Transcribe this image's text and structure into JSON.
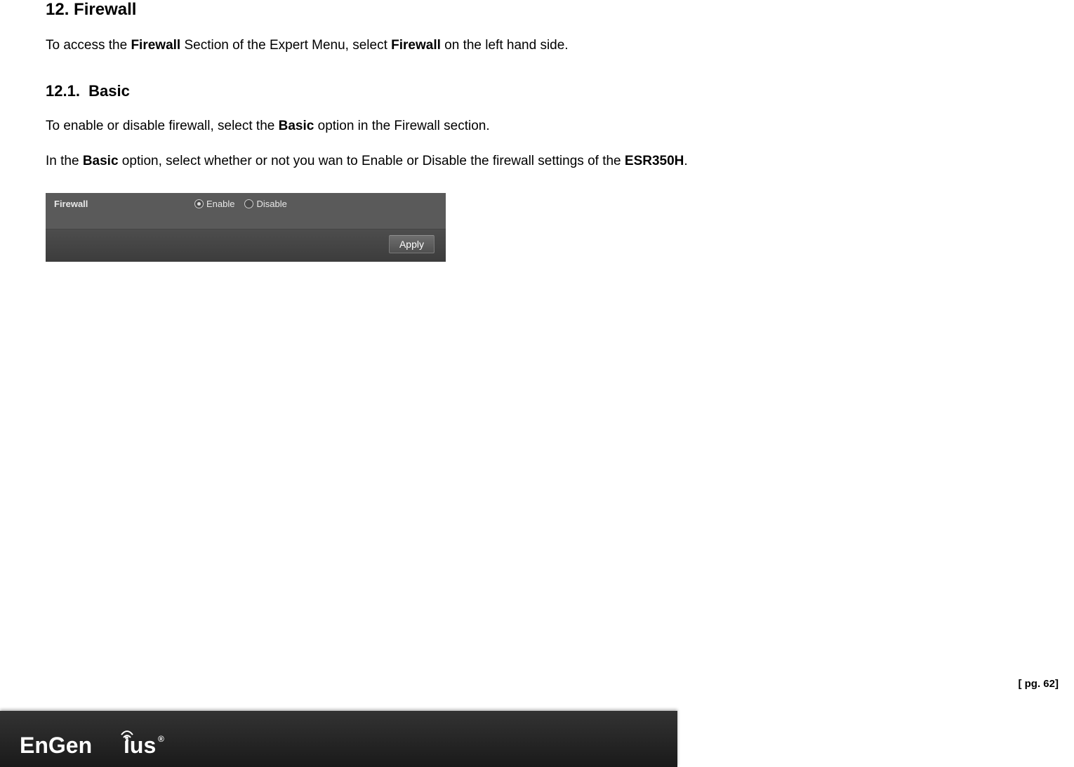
{
  "heading": {
    "number": "12.",
    "title": "Firewall"
  },
  "intro": {
    "pre": "To access the ",
    "bold1": "Firewall",
    "mid": " Section of the Expert Menu, select ",
    "bold2": "Firewall",
    "post": " on the left hand side."
  },
  "subheading": {
    "number": "12.1.",
    "title": "Basic"
  },
  "p2": {
    "pre": "To enable or disable firewall, select the ",
    "bold": "Basic",
    "post": " option in the Firewall section."
  },
  "p3": {
    "pre": "In the ",
    "bold1": "Basic",
    "mid": " option, select whether or not you wan to Enable or Disable the firewall settings of the ",
    "bold2": "ESR350H",
    "post": "."
  },
  "firewall_panel": {
    "label": "Firewall",
    "enable_label": "Enable",
    "disable_label": "Disable",
    "apply_label": "Apply"
  },
  "footer": {
    "logo_text": "EnGenius",
    "page_label": "[ pg. 62]"
  }
}
